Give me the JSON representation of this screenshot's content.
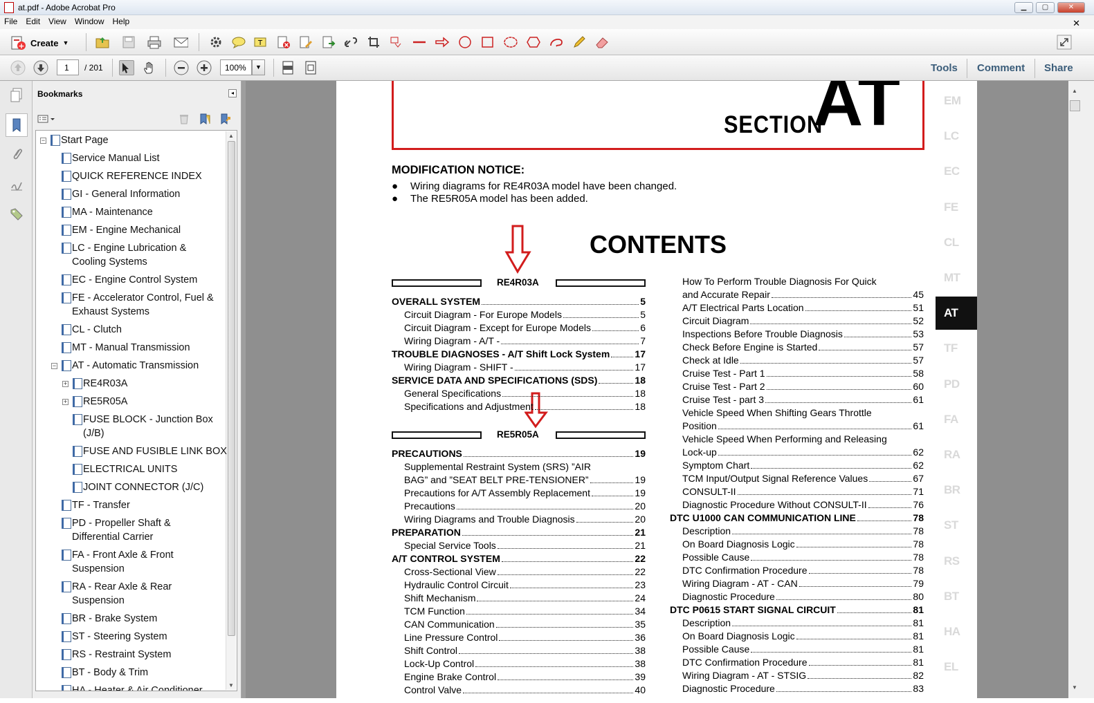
{
  "window": {
    "title": "at.pdf - Adobe Acrobat Pro",
    "btn_min": "▭",
    "btn_max": "▭",
    "btn_close": "✕"
  },
  "menu": [
    "File",
    "Edit",
    "View",
    "Window",
    "Help"
  ],
  "toolbar": {
    "create_label": "Create",
    "page_current": "1",
    "page_total": "/ 201",
    "zoom": "100%"
  },
  "right_links": {
    "tools": "Tools",
    "comment": "Comment",
    "share": "Share"
  },
  "bookmarks": {
    "title": "Bookmarks",
    "items": [
      {
        "label": "Start Page",
        "level": 0,
        "expand": "minus"
      },
      {
        "label": "Service Manual List",
        "level": 1
      },
      {
        "label": "QUICK REFERENCE INDEX",
        "level": 1
      },
      {
        "label": "GI - General Information",
        "level": 1
      },
      {
        "label": "MA - Maintenance",
        "level": 1
      },
      {
        "label": "EM - Engine Mechanical",
        "level": 1
      },
      {
        "label": "LC - Engine Lubrication &",
        "label2": "Cooling Systems",
        "level": 1
      },
      {
        "label": "EC - Engine Control System",
        "level": 1
      },
      {
        "label": "FE - Accelerator Control, Fuel &",
        "label2": "Exhaust Systems",
        "level": 1
      },
      {
        "label": "CL - Clutch",
        "level": 1
      },
      {
        "label": "MT - Manual Transmission",
        "level": 1
      },
      {
        "label": "AT - Automatic Transmission",
        "level": 1,
        "expand": "minus"
      },
      {
        "label": "RE4R03A",
        "level": 2,
        "expand": "plus"
      },
      {
        "label": "RE5R05A",
        "level": 2,
        "expand": "plus"
      },
      {
        "label": "FUSE BLOCK - Junction Box",
        "label2": "(J/B)",
        "level": 2
      },
      {
        "label": "FUSE AND FUSIBLE LINK BOX",
        "level": 2
      },
      {
        "label": "ELECTRICAL UNITS",
        "level": 2
      },
      {
        "label": "JOINT CONNECTOR (J/C)",
        "level": 2
      },
      {
        "label": "TF - Transfer",
        "level": 1
      },
      {
        "label": "PD - Propeller Shaft &",
        "label2": "Differential Carrier",
        "level": 1
      },
      {
        "label": "FA - Front Axle & Front",
        "label2": "Suspension",
        "level": 1
      },
      {
        "label": "RA - Rear Axle & Rear",
        "label2": "Suspension",
        "level": 1
      },
      {
        "label": "BR - Brake System",
        "level": 1
      },
      {
        "label": "ST - Steering System",
        "level": 1
      },
      {
        "label": "RS - Restraint System",
        "level": 1
      },
      {
        "label": "BT - Body & Trim",
        "level": 1
      },
      {
        "label": "HA - Heater & Air Conditioner",
        "level": 1
      }
    ]
  },
  "document": {
    "section_word": "SECTION",
    "section_code": "AT",
    "notice_title": "MODIFICATION NOTICE:",
    "notices": [
      "Wiring diagrams for RE4R03A model have been changed.",
      "The RE5R05A model has been added."
    ],
    "bullet": "●",
    "contents_title": "CONTENTS",
    "group1": "RE4R03A",
    "group2": "RE5R05A",
    "left_col": [
      {
        "t": "OVERALL SYSTEM",
        "n": "5",
        "b": true,
        "i": 0
      },
      {
        "t": "Circuit Diagram - For Europe Models",
        "n": "5",
        "i": 1
      },
      {
        "t": "Circuit Diagram - Except for Europe Models",
        "n": "6",
        "i": 1
      },
      {
        "t": "Wiring Diagram - A/T -",
        "n": "7",
        "i": 1
      },
      {
        "t": "TROUBLE DIAGNOSES - A/T Shift Lock System",
        "n": "17",
        "b": true,
        "i": 0
      },
      {
        "t": "Wiring Diagram - SHIFT -",
        "n": "17",
        "i": 1
      },
      {
        "t": "SERVICE DATA AND SPECIFICATIONS (SDS)",
        "n": "18",
        "b": true,
        "i": 0
      },
      {
        "t": "General Specifications",
        "n": "18",
        "i": 1
      },
      {
        "t": "Specifications and Adjustment",
        "n": "18",
        "i": 1
      }
    ],
    "left_col2": [
      {
        "t": "PRECAUTIONS",
        "n": "19",
        "b": true,
        "i": 0
      },
      {
        "t": "Supplemental Restraint System (SRS) ”AIR",
        "n": "",
        "i": 1,
        "nodots": true
      },
      {
        "t": "BAG” and ”SEAT BELT PRE-TENSIONER”",
        "n": "19",
        "i": 1
      },
      {
        "t": "Precautions for A/T Assembly Replacement",
        "n": "19",
        "i": 1
      },
      {
        "t": "Precautions",
        "n": "20",
        "i": 1
      },
      {
        "t": "Wiring Diagrams and Trouble Diagnosis",
        "n": "20",
        "i": 1
      },
      {
        "t": "PREPARATION",
        "n": "21",
        "b": true,
        "i": 0
      },
      {
        "t": "Special Service Tools",
        "n": "21",
        "i": 1
      },
      {
        "t": "A/T CONTROL SYSTEM",
        "n": "22",
        "b": true,
        "i": 0
      },
      {
        "t": "Cross-Sectional View",
        "n": "22",
        "i": 1
      },
      {
        "t": "Hydraulic Control Circuit",
        "n": "23",
        "i": 1
      },
      {
        "t": "Shift Mechanism",
        "n": "24",
        "i": 1
      },
      {
        "t": "TCM Function",
        "n": "34",
        "i": 1
      },
      {
        "t": "CAN Communication",
        "n": "35",
        "i": 1
      },
      {
        "t": "Line Pressure Control",
        "n": "36",
        "i": 1
      },
      {
        "t": "Shift Control",
        "n": "38",
        "i": 1
      },
      {
        "t": "Lock-Up Control",
        "n": "38",
        "i": 1
      },
      {
        "t": "Engine Brake Control",
        "n": "39",
        "i": 1
      },
      {
        "t": "Control Valve",
        "n": "40",
        "i": 1
      }
    ],
    "right_col": [
      {
        "t": "How To Perform Trouble Diagnosis For Quick",
        "n": "",
        "i": 1,
        "nodots": true
      },
      {
        "t": "and Accurate Repair",
        "n": "45",
        "i": 1
      },
      {
        "t": "A/T Electrical Parts Location",
        "n": "51",
        "i": 1
      },
      {
        "t": "Circuit Diagram",
        "n": "52",
        "i": 1
      },
      {
        "t": "Inspections Before Trouble Diagnosis",
        "n": "53",
        "i": 1
      },
      {
        "t": "Check Before Engine is Started",
        "n": "57",
        "i": 1
      },
      {
        "t": "Check at Idle",
        "n": "57",
        "i": 1
      },
      {
        "t": "Cruise Test - Part 1",
        "n": "58",
        "i": 1
      },
      {
        "t": "Cruise Test - Part 2",
        "n": "60",
        "i": 1
      },
      {
        "t": "Cruise Test - part 3",
        "n": "61",
        "i": 1
      },
      {
        "t": "Vehicle Speed When Shifting Gears Throttle",
        "n": "",
        "i": 1,
        "nodots": true
      },
      {
        "t": "Position",
        "n": "61",
        "i": 1
      },
      {
        "t": "Vehicle Speed When Performing and Releasing",
        "n": "",
        "i": 1,
        "nodots": true
      },
      {
        "t": "Lock-up",
        "n": "62",
        "i": 1
      },
      {
        "t": "Symptom Chart",
        "n": "62",
        "i": 1
      },
      {
        "t": "TCM Input/Output Signal Reference Values",
        "n": "67",
        "i": 1
      },
      {
        "t": "CONSULT-II",
        "n": "71",
        "i": 1
      },
      {
        "t": "Diagnostic Procedure Without CONSULT-II",
        "n": "76",
        "i": 1
      },
      {
        "t": "DTC U1000 CAN COMMUNICATION LINE",
        "n": "78",
        "b": true,
        "i": 0
      },
      {
        "t": "Description",
        "n": "78",
        "i": 1
      },
      {
        "t": "On Board Diagnosis Logic",
        "n": "78",
        "i": 1
      },
      {
        "t": "Possible Cause",
        "n": "78",
        "i": 1
      },
      {
        "t": "DTC Confirmation Procedure",
        "n": "78",
        "i": 1
      },
      {
        "t": "Wiring Diagram - AT - CAN",
        "n": "79",
        "i": 1
      },
      {
        "t": "Diagnostic Procedure",
        "n": "80",
        "i": 1
      },
      {
        "t": "DTC P0615 START SIGNAL CIRCUIT",
        "n": "81",
        "b": true,
        "i": 0
      },
      {
        "t": "Description",
        "n": "81",
        "i": 1
      },
      {
        "t": "On Board Diagnosis Logic",
        "n": "81",
        "i": 1
      },
      {
        "t": "Possible Cause",
        "n": "81",
        "i": 1
      },
      {
        "t": "DTC Confirmation Procedure",
        "n": "81",
        "i": 1
      },
      {
        "t": "Wiring Diagram - AT - STSIG",
        "n": "82",
        "i": 1
      },
      {
        "t": "Diagnostic Procedure",
        "n": "83",
        "i": 1
      }
    ],
    "tabs": [
      "EM",
      "LC",
      "EC",
      "FE",
      "CL",
      "MT",
      "AT",
      "TF",
      "PD",
      "FA",
      "RA",
      "BR",
      "ST",
      "RS",
      "BT",
      "HA",
      "EL"
    ],
    "active_tab": "AT"
  },
  "colors": {
    "accent_red": "#d21c1c",
    "link_blue": "#3b5d7a"
  }
}
